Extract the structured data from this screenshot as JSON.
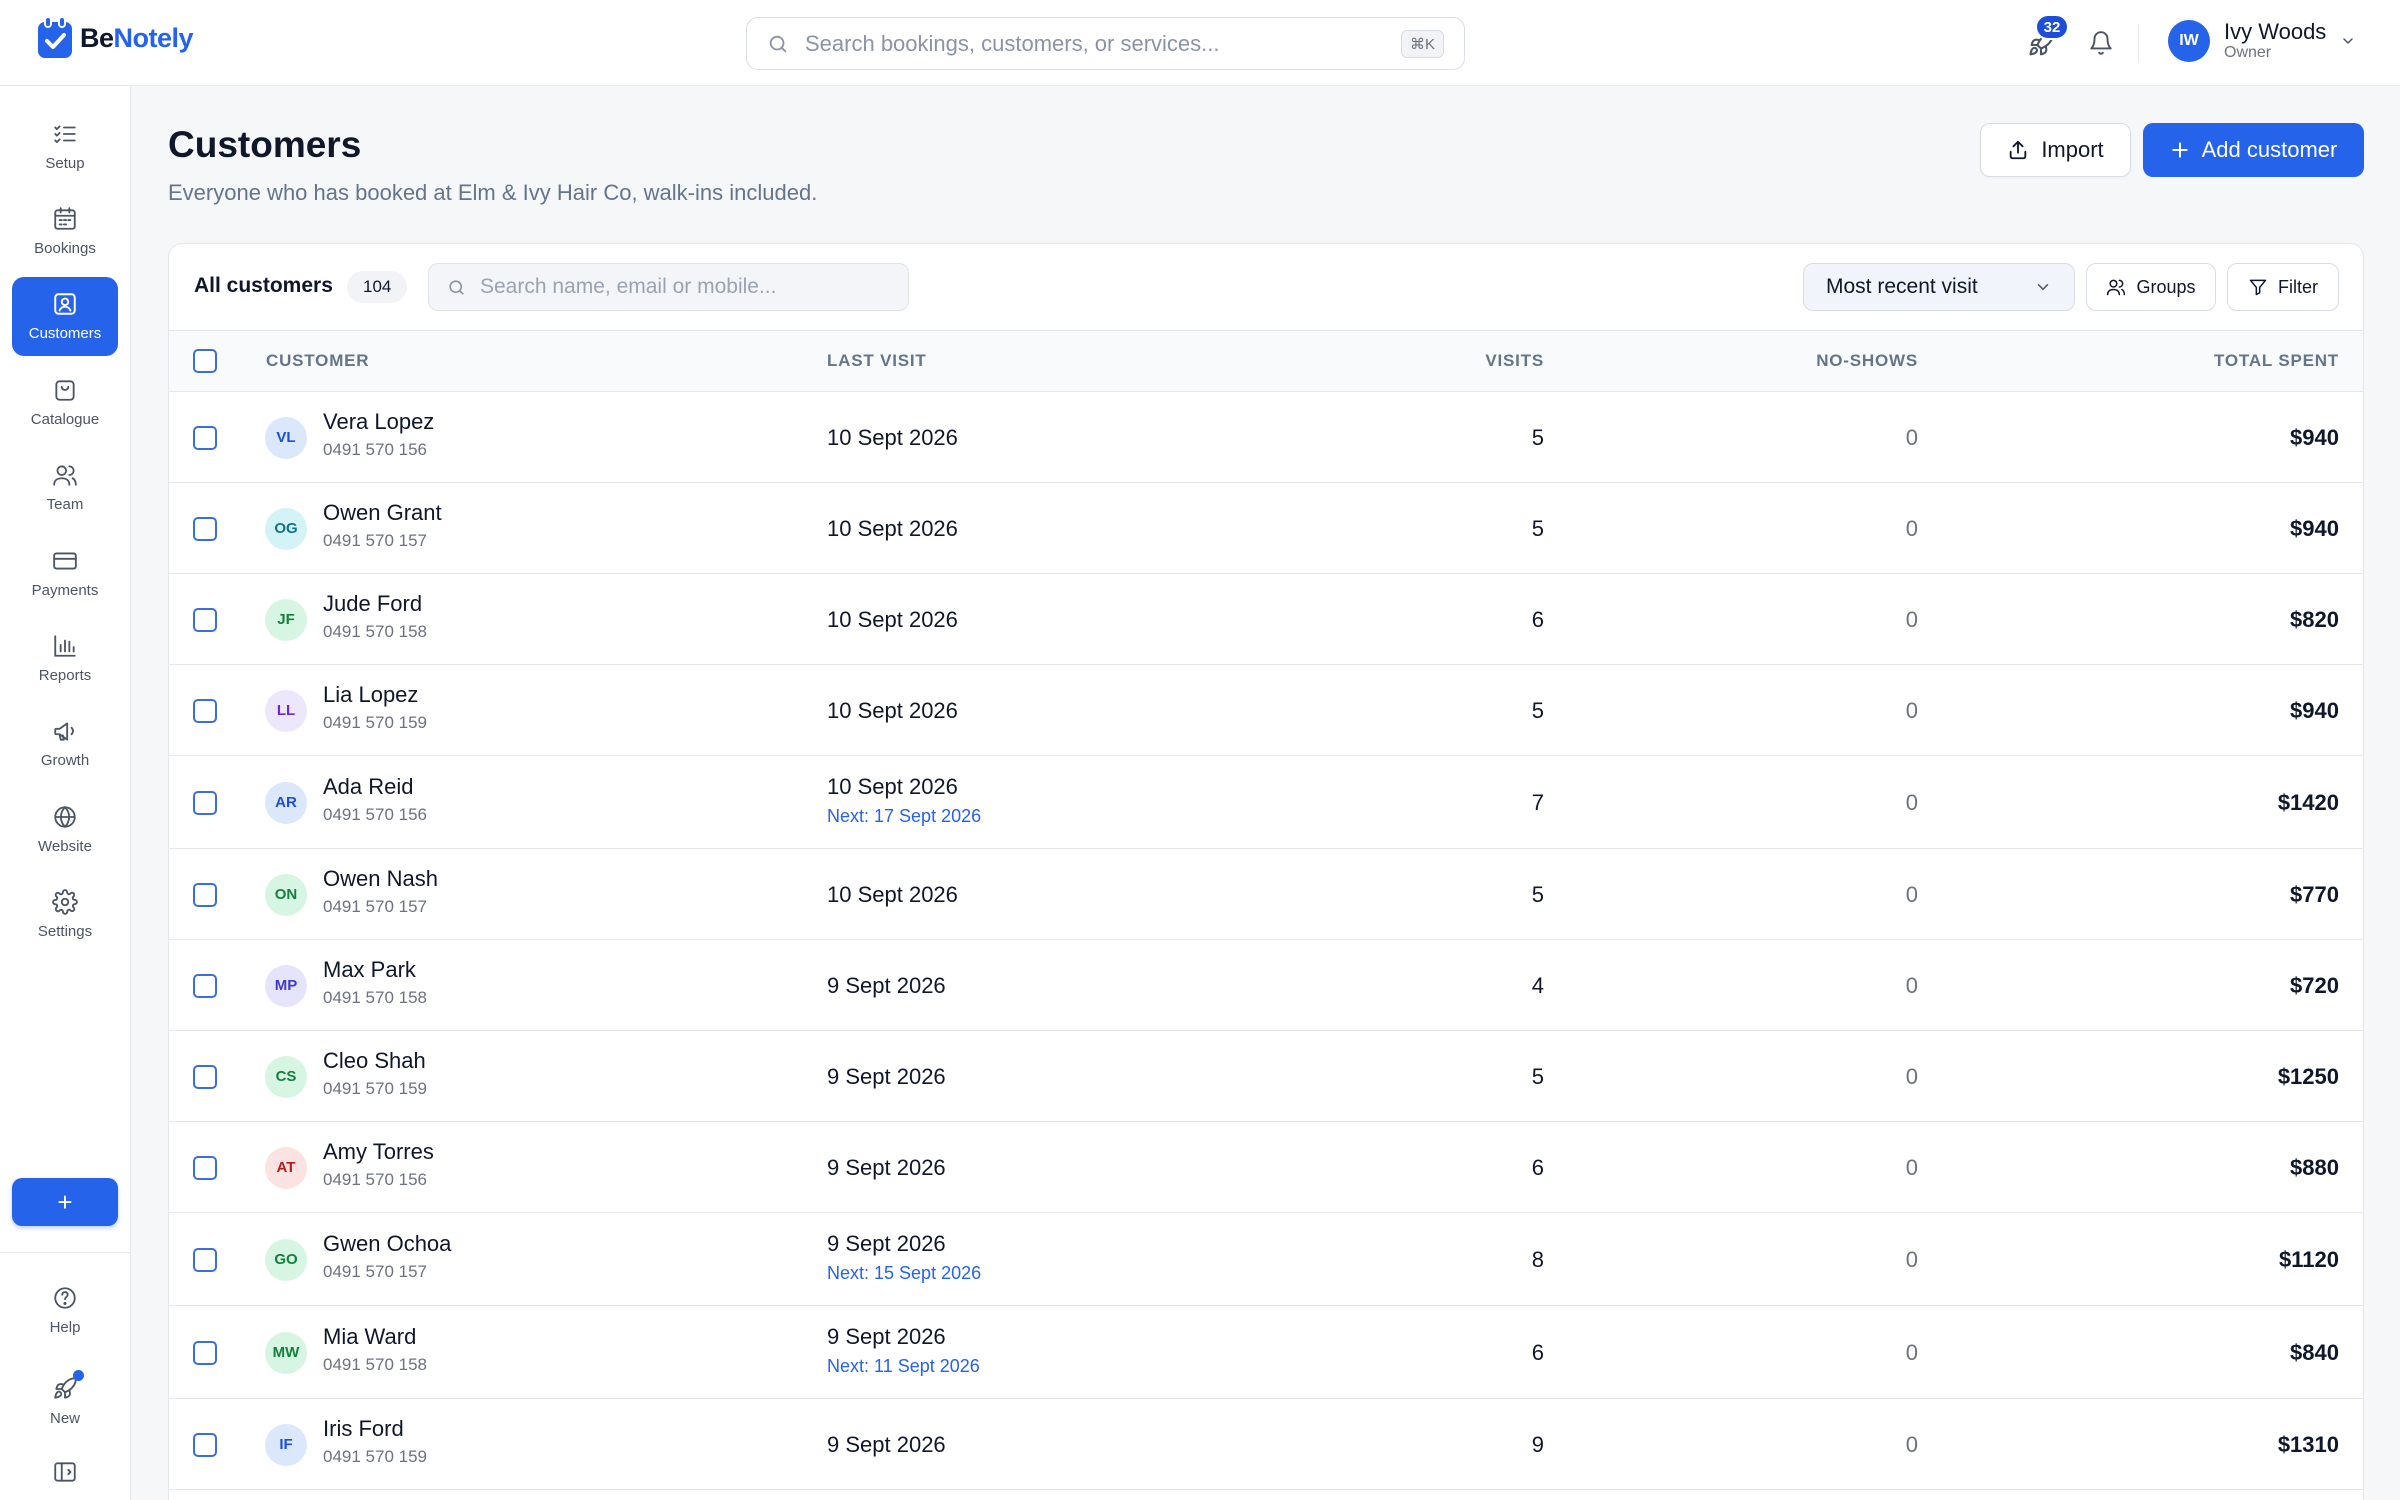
{
  "brand": {
    "name_part1": "Be",
    "name_part2": "Notely",
    "color": "#2563eb"
  },
  "header": {
    "search_placeholder": "Search bookings, customers, or services...",
    "search_shortcut": "⌘K",
    "whats_new_count": "32",
    "user": {
      "initials": "IW",
      "name": "Ivy Woods",
      "role": "Owner"
    }
  },
  "sidebar": {
    "items": [
      {
        "label": "Setup",
        "icon": "checklist-icon"
      },
      {
        "label": "Bookings",
        "icon": "calendar-icon"
      },
      {
        "label": "Customers",
        "icon": "contact-card-icon",
        "active": true
      },
      {
        "label": "Catalogue",
        "icon": "shopping-bag-icon"
      },
      {
        "label": "Team",
        "icon": "users-icon"
      },
      {
        "label": "Payments",
        "icon": "credit-card-icon"
      },
      {
        "label": "Reports",
        "icon": "bar-chart-icon"
      },
      {
        "label": "Growth",
        "icon": "megaphone-icon"
      },
      {
        "label": "Website",
        "icon": "globe-icon"
      },
      {
        "label": "Settings",
        "icon": "gear-icon"
      }
    ],
    "fab_label": "+",
    "bottom": [
      {
        "label": "Help",
        "icon": "help-circle-icon"
      },
      {
        "label": "New",
        "icon": "rocket-icon"
      }
    ]
  },
  "page": {
    "title": "Customers",
    "subtitle": "Everyone who has booked at Elm & Ivy Hair Co, walk-ins included.",
    "import_label": "Import",
    "add_label": "Add customer"
  },
  "toolbar": {
    "title": "All customers",
    "count": "104",
    "search_placeholder": "Search name, email or mobile...",
    "sort_value": "Most recent visit",
    "groups_label": "Groups",
    "filter_label": "Filter"
  },
  "table": {
    "headers": {
      "customer": "Customer",
      "last_visit": "Last visit",
      "visits": "Visits",
      "no_shows": "No-shows",
      "total_spent": "Total spent"
    },
    "rows": [
      {
        "initials": "VL",
        "name": "Vera Lopez",
        "phone": "0491 570 156",
        "last_visit": "10 Sept 2026",
        "next": "",
        "visits": "5",
        "no_shows": "0",
        "spent": "$940",
        "av_bg": "#dbe7fb",
        "av_fg": "#1d4ed8"
      },
      {
        "initials": "OG",
        "name": "Owen Grant",
        "phone": "0491 570 157",
        "last_visit": "10 Sept 2026",
        "next": "",
        "visits": "5",
        "no_shows": "0",
        "spent": "$940",
        "av_bg": "#d4f3f6",
        "av_fg": "#0e7490"
      },
      {
        "initials": "JF",
        "name": "Jude Ford",
        "phone": "0491 570 158",
        "last_visit": "10 Sept 2026",
        "next": "",
        "visits": "6",
        "no_shows": "0",
        "spent": "$820",
        "av_bg": "#d7f5e3",
        "av_fg": "#15803d"
      },
      {
        "initials": "LL",
        "name": "Lia Lopez",
        "phone": "0491 570 159",
        "last_visit": "10 Sept 2026",
        "next": "",
        "visits": "5",
        "no_shows": "0",
        "spent": "$940",
        "av_bg": "#ede7fb",
        "av_fg": "#6d28d9"
      },
      {
        "initials": "AR",
        "name": "Ada Reid",
        "phone": "0491 570 156",
        "last_visit": "10 Sept 2026",
        "next": "Next: 17 Sept 2026",
        "visits": "7",
        "no_shows": "0",
        "spent": "$1420",
        "av_bg": "#dbe7fb",
        "av_fg": "#1d4ed8"
      },
      {
        "initials": "ON",
        "name": "Owen Nash",
        "phone": "0491 570 157",
        "last_visit": "10 Sept 2026",
        "next": "",
        "visits": "5",
        "no_shows": "0",
        "spent": "$770",
        "av_bg": "#d7f5e3",
        "av_fg": "#15803d"
      },
      {
        "initials": "MP",
        "name": "Max Park",
        "phone": "0491 570 158",
        "last_visit": "9 Sept 2026",
        "next": "",
        "visits": "4",
        "no_shows": "0",
        "spent": "$720",
        "av_bg": "#e4e4fb",
        "av_fg": "#4338ca"
      },
      {
        "initials": "CS",
        "name": "Cleo Shah",
        "phone": "0491 570 159",
        "last_visit": "9 Sept 2026",
        "next": "",
        "visits": "5",
        "no_shows": "0",
        "spent": "$1250",
        "av_bg": "#d7f5e3",
        "av_fg": "#15803d"
      },
      {
        "initials": "AT",
        "name": "Amy Torres",
        "phone": "0491 570 156",
        "last_visit": "9 Sept 2026",
        "next": "",
        "visits": "6",
        "no_shows": "0",
        "spent": "$880",
        "av_bg": "#fde2e2",
        "av_fg": "#b91c1c"
      },
      {
        "initials": "GO",
        "name": "Gwen Ochoa",
        "phone": "0491 570 157",
        "last_visit": "9 Sept 2026",
        "next": "Next: 15 Sept 2026",
        "visits": "8",
        "no_shows": "0",
        "spent": "$1120",
        "av_bg": "#d7f5e3",
        "av_fg": "#15803d"
      },
      {
        "initials": "MW",
        "name": "Mia Ward",
        "phone": "0491 570 158",
        "last_visit": "9 Sept 2026",
        "next": "Next: 11 Sept 2026",
        "visits": "6",
        "no_shows": "0",
        "spent": "$840",
        "av_bg": "#d7f5e3",
        "av_fg": "#15803d"
      },
      {
        "initials": "IF",
        "name": "Iris Ford",
        "phone": "0491 570 159",
        "last_visit": "9 Sept 2026",
        "next": "",
        "visits": "9",
        "no_shows": "0",
        "spent": "$1310",
        "av_bg": "#dbe7fb",
        "av_fg": "#1d4ed8"
      }
    ]
  }
}
